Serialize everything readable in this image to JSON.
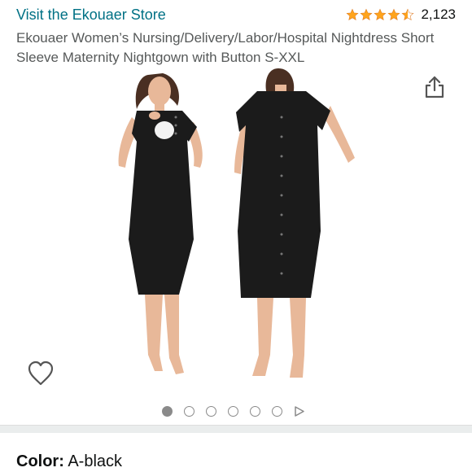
{
  "header": {
    "store_link": "Visit the Ekouaer Store",
    "rating_value": 4.5,
    "rating_count": "2,123",
    "title": "Ekouaer Women’s Nursing/Delivery/Labor/Hospital Nightdress Short Sleeve Maternity Nightgown with Button S-XXL"
  },
  "gallery": {
    "image_count": 6,
    "active_index": 0
  },
  "variation": {
    "color_label": "Color:",
    "color_value": "A-black"
  },
  "colors": {
    "link": "#007185",
    "star": "#ffa41c",
    "dress": "#1b1b1b"
  },
  "icons": {
    "share": "share-icon",
    "wishlist": "heart-outline-icon",
    "next": "play-triangle-icon"
  }
}
